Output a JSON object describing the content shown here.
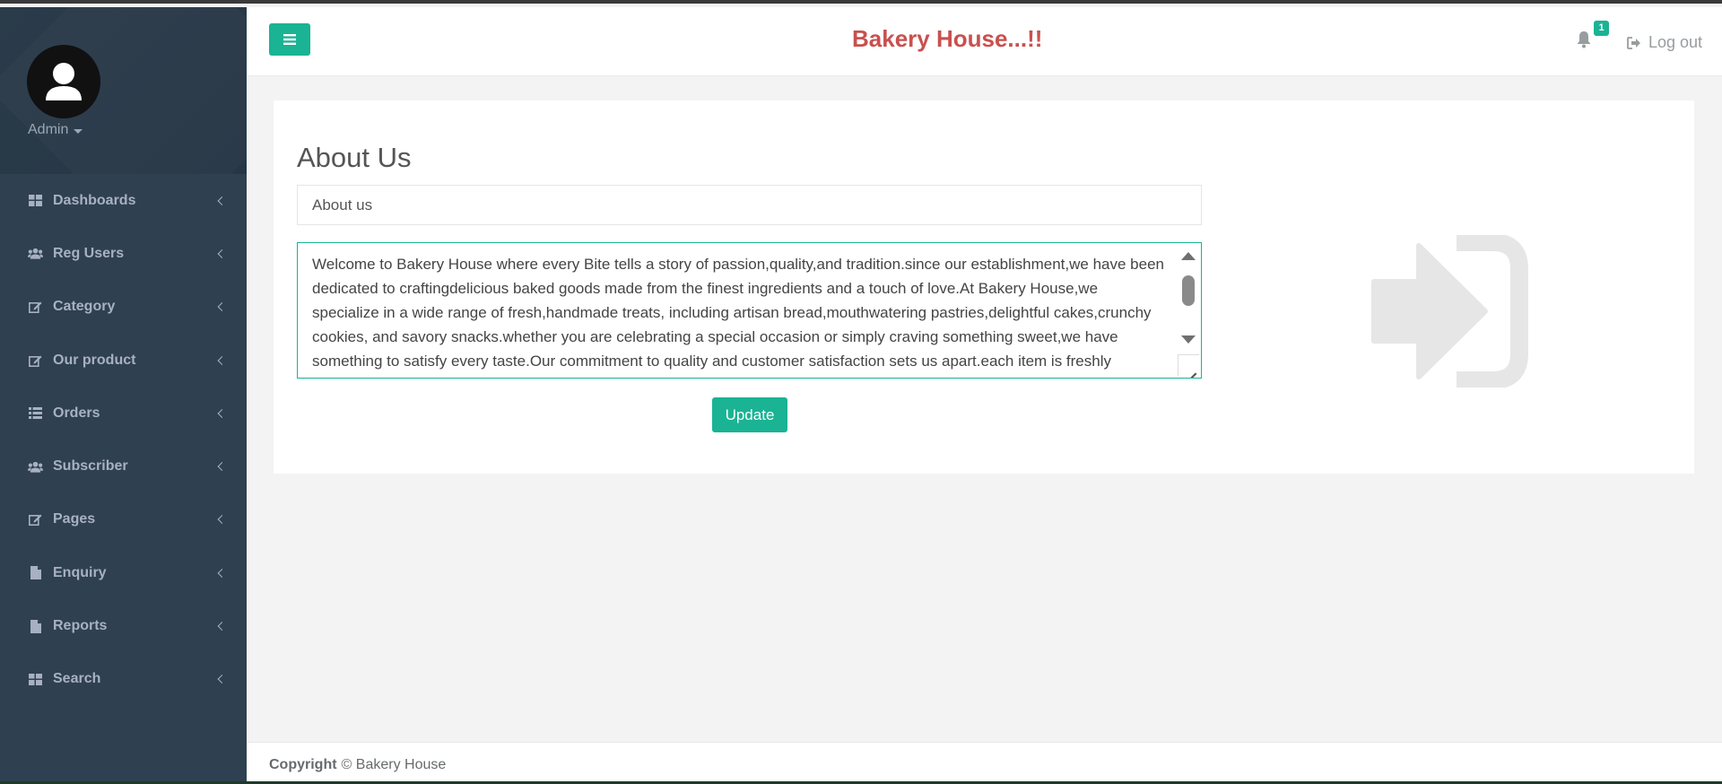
{
  "sidebar": {
    "user_name": "Admin",
    "items": [
      {
        "label": "Dashboards",
        "icon": "dashboard-icon"
      },
      {
        "label": "Reg Users",
        "icon": "users-icon"
      },
      {
        "label": "Category",
        "icon": "edit-icon"
      },
      {
        "label": "Our product",
        "icon": "edit-icon"
      },
      {
        "label": "Orders",
        "icon": "list-icon"
      },
      {
        "label": "Subscriber",
        "icon": "users-icon"
      },
      {
        "label": "Pages",
        "icon": "edit-icon"
      },
      {
        "label": "Enquiry",
        "icon": "file-icon"
      },
      {
        "label": "Reports",
        "icon": "file-icon"
      },
      {
        "label": "Search",
        "icon": "dashboard-icon"
      }
    ]
  },
  "header": {
    "title": "Bakery House...!!",
    "notification_count": "1",
    "logout_label": "Log out"
  },
  "main": {
    "page_title": "About Us",
    "title_value": "About us",
    "description": "Welcome to Bakery House where every Bite tells a story of passion,quality,and tradition.since our establishment,we have been dedicated to craftingdelicious baked goods made from the finest ingredients and a touch of love.At Bakery House,we specialize in a wide range of fresh,handmade treats, including artisan bread,mouthwatering pastries,delightful cakes,crunchy cookies, and savory snacks.whether you are celebrating a special occasion or simply craving something sweet,we have something to satisfy every taste.Our commitment to quality and customer satisfaction sets us apart.each item is freshly prepared daily, using recipes perfected over years of experience and dedication.",
    "update_label": "Update"
  },
  "footer": {
    "copyright_label": "Copyright",
    "copyright_text": "© Bakery House"
  },
  "colors": {
    "accent": "#1ab394",
    "sidebar_bg": "#2f4050",
    "title_red": "#c9504e"
  }
}
